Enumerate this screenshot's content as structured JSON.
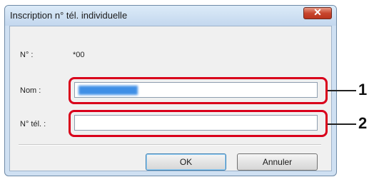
{
  "window": {
    "title": "Inscription n° tél. individuelle",
    "close_glyph": "✕"
  },
  "form": {
    "number_label": "N° :",
    "number_value": "*00",
    "name_label": "Nom :",
    "name_value": "",
    "phone_label": "N° tél. :",
    "phone_value": ""
  },
  "buttons": {
    "ok_label": "OK",
    "cancel_label": "Annuler"
  },
  "callouts": {
    "one": "1",
    "two": "2"
  },
  "colors": {
    "highlight": "#d9001b",
    "selection": "#3f8fe6"
  }
}
